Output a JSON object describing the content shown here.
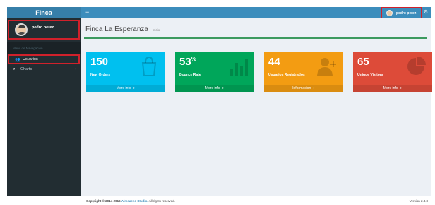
{
  "app": {
    "brand": "Finca"
  },
  "user": {
    "name": "pedro perez"
  },
  "sidebar": {
    "nav_header": "Menu de Navegacion",
    "items": [
      {
        "label": "Usuarios",
        "icon": "users-icon"
      },
      {
        "label": "Charts",
        "icon": "pie-chart-icon"
      }
    ]
  },
  "topbar": {
    "menu_icon": "≡",
    "gears_icon": "⚙"
  },
  "page": {
    "title": "Finca La Esperanza",
    "subtitle": "Inicio"
  },
  "boxes": [
    {
      "value": "150",
      "suffix": "",
      "label": "New Orders",
      "footer": "More info",
      "color": "#00c0ef",
      "icon": "shopping-bag-icon"
    },
    {
      "value": "53",
      "suffix": "%",
      "label": "Bounce Rate",
      "footer": "More info",
      "color": "#00a65a",
      "icon": "bar-chart-icon"
    },
    {
      "value": "44",
      "suffix": "",
      "label": "Usuarios Registrados",
      "footer": "Informacion",
      "color": "#f39c12",
      "icon": "user-add-icon"
    },
    {
      "value": "65",
      "suffix": "",
      "label": "Unique Visitors",
      "footer": "More info",
      "color": "#dd4b39",
      "icon": "pie-chart-icon"
    }
  ],
  "footer": {
    "copyright_prefix": "Copyright © 2014-2016",
    "company": "Almsaeed Studio.",
    "rights": "All rights reserved.",
    "version": "Version 2.3.8"
  }
}
